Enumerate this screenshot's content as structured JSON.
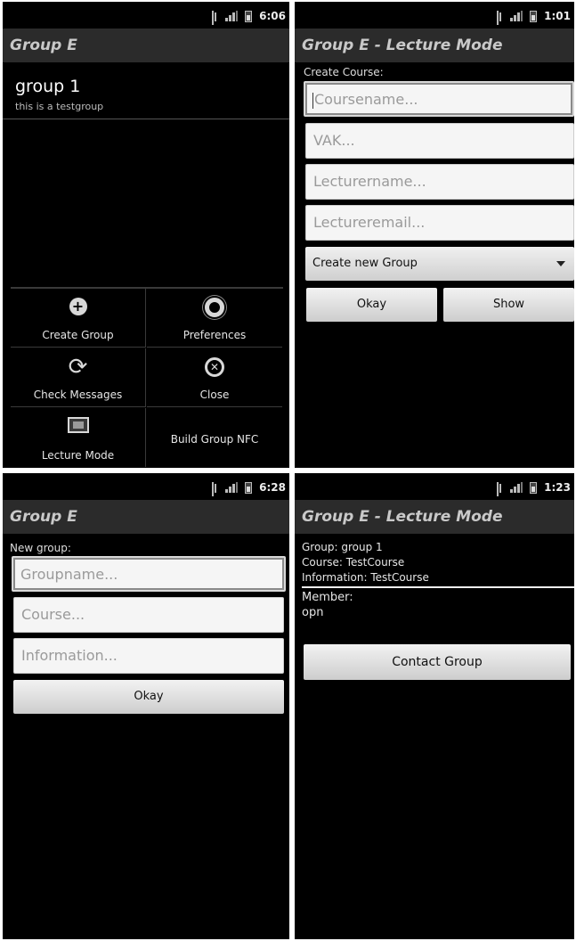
{
  "screens": [
    {
      "clock": "6:06",
      "title": "Group E",
      "list": [
        {
          "title": "group 1",
          "subtitle": "this is a testgroup"
        }
      ],
      "menu": [
        {
          "label": "Create Group",
          "icon": "add-circle-icon"
        },
        {
          "label": "Preferences",
          "icon": "gear-icon"
        },
        {
          "label": "Check Messages",
          "icon": "refresh-icon"
        },
        {
          "label": "Close",
          "icon": "close-circle-icon"
        },
        {
          "label": "Lecture Mode",
          "icon": "picture-icon"
        },
        {
          "label": "Build Group NFC",
          "icon": ""
        }
      ]
    },
    {
      "clock": "1:01",
      "title": "Group E - Lecture Mode",
      "section_label": "Create Course:",
      "fields": [
        {
          "placeholder": "Coursename..."
        },
        {
          "placeholder": "VAK..."
        },
        {
          "placeholder": "Lecturername..."
        },
        {
          "placeholder": "Lectureremail..."
        }
      ],
      "spinner": "Create new Group",
      "buttons": [
        "Okay",
        "Show"
      ]
    },
    {
      "clock": "6:28",
      "title": "Group E",
      "section_label": "New group:",
      "fields": [
        {
          "placeholder": "Groupname..."
        },
        {
          "placeholder": "Course..."
        },
        {
          "placeholder": "Information..."
        }
      ],
      "button": "Okay"
    },
    {
      "clock": "1:23",
      "title": "Group E - Lecture Mode",
      "info": [
        "Group: group 1",
        "Course: TestCourse",
        "Information: TestCourse"
      ],
      "member_label": "Member:",
      "member_value": "opn",
      "button": "Contact Group"
    }
  ]
}
